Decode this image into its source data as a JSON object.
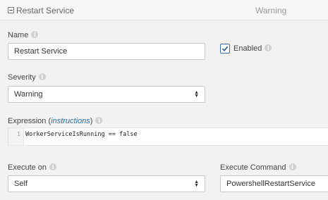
{
  "header": {
    "title": "Restart Service",
    "severity": "Warning"
  },
  "name_field": {
    "label": "Name",
    "value": "Restart Service"
  },
  "enabled": {
    "label": "Enabled",
    "checked": true
  },
  "severity_field": {
    "label": "Severity",
    "selected": "Warning"
  },
  "expression": {
    "label": "Expression",
    "instructions_link": "instructions",
    "line_number": "1",
    "code": "WorkerServiceIsRunning == false"
  },
  "execute_on": {
    "label": "Execute on",
    "selected": "Self"
  },
  "execute_command": {
    "label": "Execute Command",
    "value": "PowershellRestartService"
  },
  "info_icon_glyph": "i",
  "colors": {
    "link": "#2b6fa8",
    "checkbox_border": "#3a6ea5"
  }
}
